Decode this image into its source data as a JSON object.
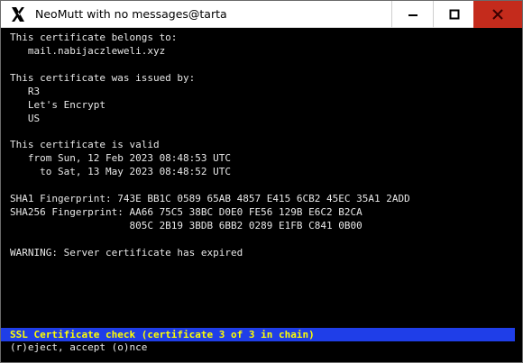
{
  "window": {
    "title": "NeoMutt with no messages@tarta"
  },
  "terminal": {
    "lines": [
      "This certificate belongs to:",
      "   mail.nabijaczleweli.xyz",
      "",
      "This certificate was issued by:",
      "   R3",
      "   Let's Encrypt",
      "   US",
      "",
      "This certificate is valid",
      "   from Sun, 12 Feb 2023 08:48:53 UTC",
      "     to Sat, 13 May 2023 08:48:52 UTC",
      "",
      "SHA1 Fingerprint: 743E BB1C 0589 65AB 4857 E415 6CB2 45EC 35A1 2ADD",
      "SHA256 Fingerprint: AA66 75C5 38BC D0E0 FE56 129B E6C2 B2CA",
      "                    805C 2B19 3BDB 6BB2 0289 E1FB C841 0B00",
      "",
      "WARNING: Server certificate has expired"
    ],
    "status_bar": "SSL Certificate check (certificate 3 of 3 in chain)",
    "prompt": "(r)eject, accept (o)nce"
  },
  "colors": {
    "terminal_bg": "#000000",
    "terminal_fg": "#e8e8e8",
    "status_bg": "#1f3ee8",
    "status_fg": "#ffff00",
    "close_button_bg": "#c42b1c"
  },
  "icons": {
    "app": "x-logo-icon",
    "minimize": "minimize-icon",
    "maximize": "maximize-icon",
    "close": "close-icon"
  }
}
